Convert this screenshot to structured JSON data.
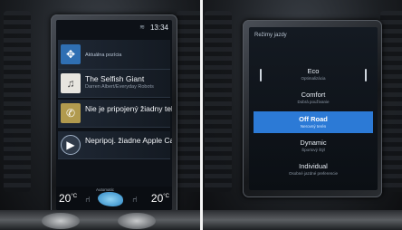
{
  "left_screen": {
    "status": {
      "time": "13:34",
      "wifi_icon": "wifi-icon"
    },
    "tiles": [
      {
        "icon": "navigation-icon",
        "title": "Aktuálna pozícia",
        "subtitle": ""
      },
      {
        "icon": "album-art-icon",
        "title": "The Selfish Giant",
        "subtitle": "Darren Albert/Everyday Robots"
      },
      {
        "icon": "phone-icon",
        "title": "Nie je pripojený žiadny telefón",
        "subtitle": ""
      },
      {
        "icon": "carplay-icon",
        "title": "Nepripoj. žiadne Apple CarPlay",
        "subtitle": ""
      }
    ],
    "climate": {
      "temp_left": "20",
      "temp_right": "20",
      "unit": "°C",
      "fan_label": "Automatic"
    }
  },
  "right_screen": {
    "title": "Režimy jazdy",
    "modes": [
      {
        "name": "Eco",
        "desc": "Optimalizácia",
        "selected": false
      },
      {
        "name": "Comfort",
        "desc": "Dobrá použivanie",
        "selected": false
      },
      {
        "name": "Off Road",
        "desc": "Nerovný terén",
        "selected": true
      },
      {
        "name": "Dynamic",
        "desc": "Športový štýl",
        "selected": false
      },
      {
        "name": "Individual",
        "desc": "Osobné jazdné preferencie",
        "selected": false
      }
    ]
  },
  "colors": {
    "accent": "#2c7ad6",
    "screen_bg": "#0d1117"
  }
}
